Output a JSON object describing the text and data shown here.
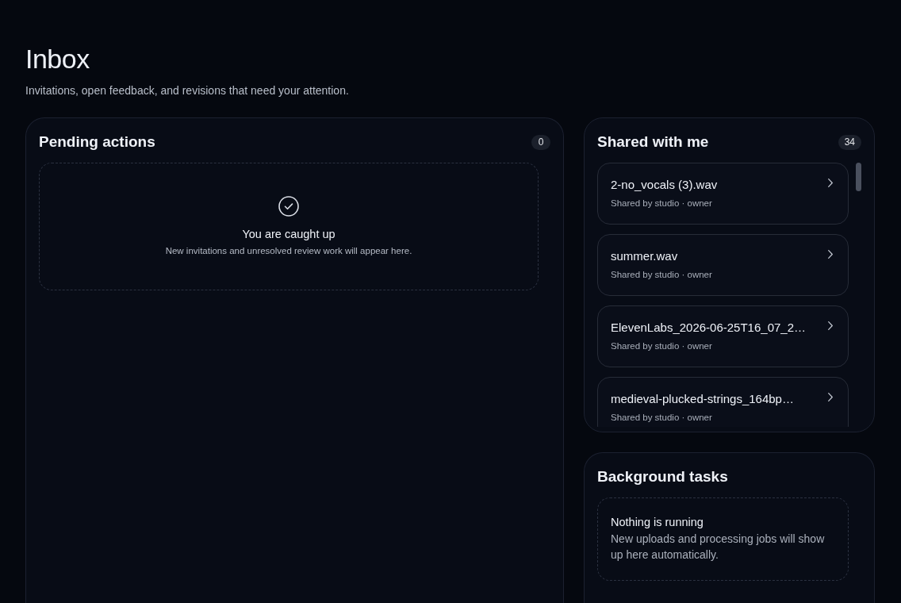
{
  "page": {
    "title": "Inbox",
    "subtitle": "Invitations, open feedback, and revisions that need your attention."
  },
  "pending_actions": {
    "title": "Pending actions",
    "count": "0",
    "empty_state": {
      "title": "You are caught up",
      "description": "New invitations and unresolved review work will appear here."
    }
  },
  "shared_with_me": {
    "title": "Shared with me",
    "count": "34",
    "items": [
      {
        "name": "2-no_vocals (3).wav",
        "meta": "Shared by studio · owner"
      },
      {
        "name": "summer.wav",
        "meta": "Shared by studio · owner"
      },
      {
        "name": "ElevenLabs_2026-06-25T16_07_2…",
        "meta": "Shared by studio · owner"
      },
      {
        "name": "medieval-plucked-strings_164bp…",
        "meta": "Shared by studio · owner"
      }
    ]
  },
  "background_tasks": {
    "title": "Background tasks",
    "empty_state": {
      "title": "Nothing is running",
      "description": "New uploads and processing jobs will show up here automatically."
    }
  }
}
